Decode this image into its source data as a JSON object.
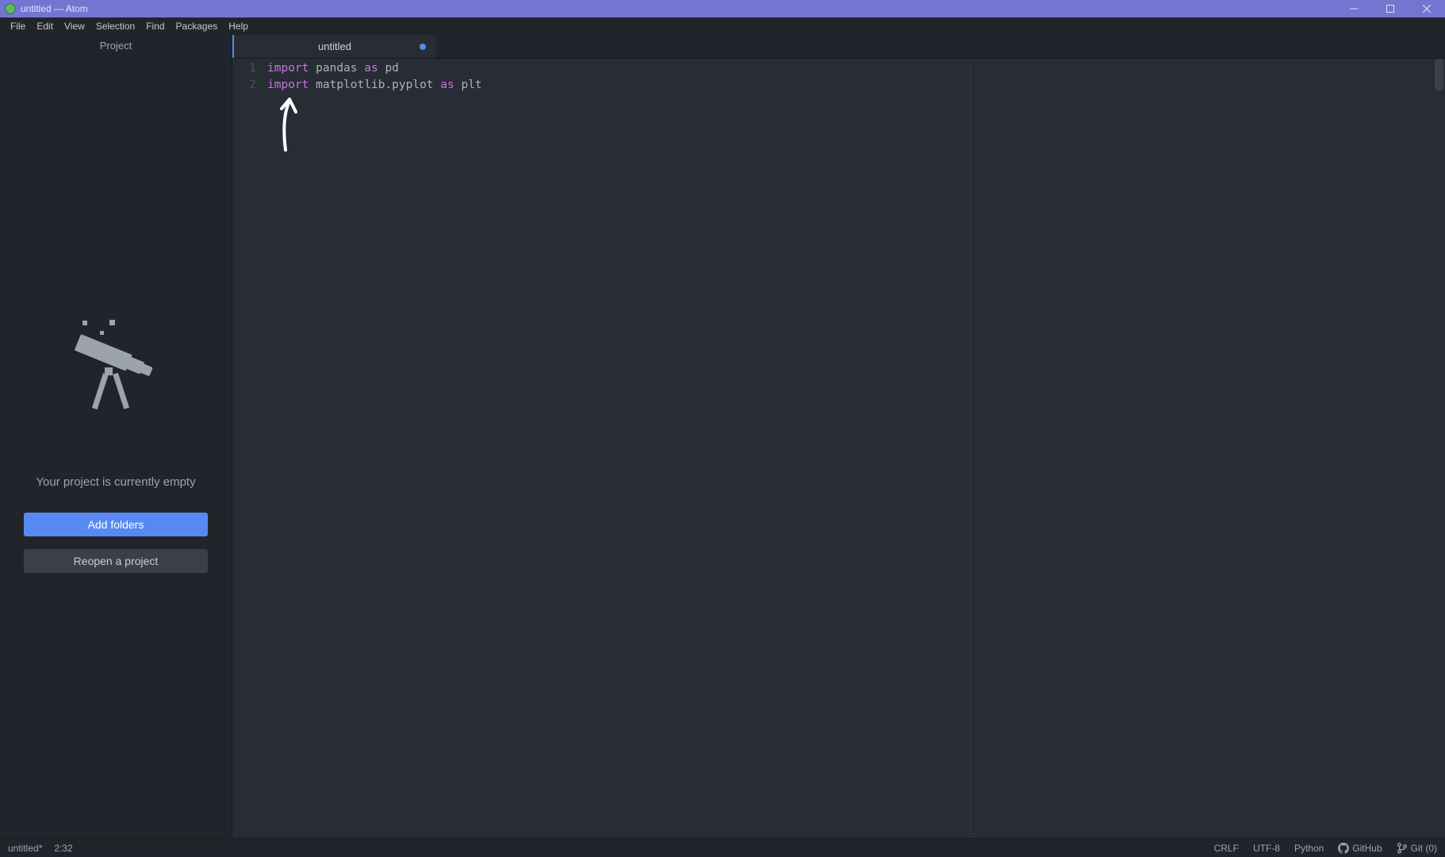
{
  "titlebar": {
    "title": "untitled — Atom"
  },
  "menubar": {
    "items": [
      "File",
      "Edit",
      "View",
      "Selection",
      "Find",
      "Packages",
      "Help"
    ]
  },
  "sidebar": {
    "header": "Project",
    "empty_message": "Your project is currently empty",
    "add_folders_label": "Add folders",
    "reopen_label": "Reopen a project"
  },
  "tab": {
    "label": "untitled"
  },
  "code": {
    "lines": [
      {
        "n": "1",
        "tokens": [
          {
            "t": "import",
            "c": "kw"
          },
          {
            "t": " "
          },
          {
            "t": "pandas",
            "c": "mod"
          },
          {
            "t": " "
          },
          {
            "t": "as",
            "c": "kw"
          },
          {
            "t": " "
          },
          {
            "t": "pd",
            "c": "alias"
          }
        ]
      },
      {
        "n": "2",
        "tokens": [
          {
            "t": "import",
            "c": "kw"
          },
          {
            "t": " "
          },
          {
            "t": "matplotlib.pyplot",
            "c": "mod"
          },
          {
            "t": " "
          },
          {
            "t": "as",
            "c": "kw"
          },
          {
            "t": " "
          },
          {
            "t": "plt",
            "c": "alias"
          }
        ]
      }
    ]
  },
  "statusbar": {
    "filename": "untitled*",
    "cursor": "2:32",
    "crlf": "CRLF",
    "encoding": "UTF-8",
    "language": "Python",
    "github": "GitHub",
    "git": "Git (0)"
  }
}
